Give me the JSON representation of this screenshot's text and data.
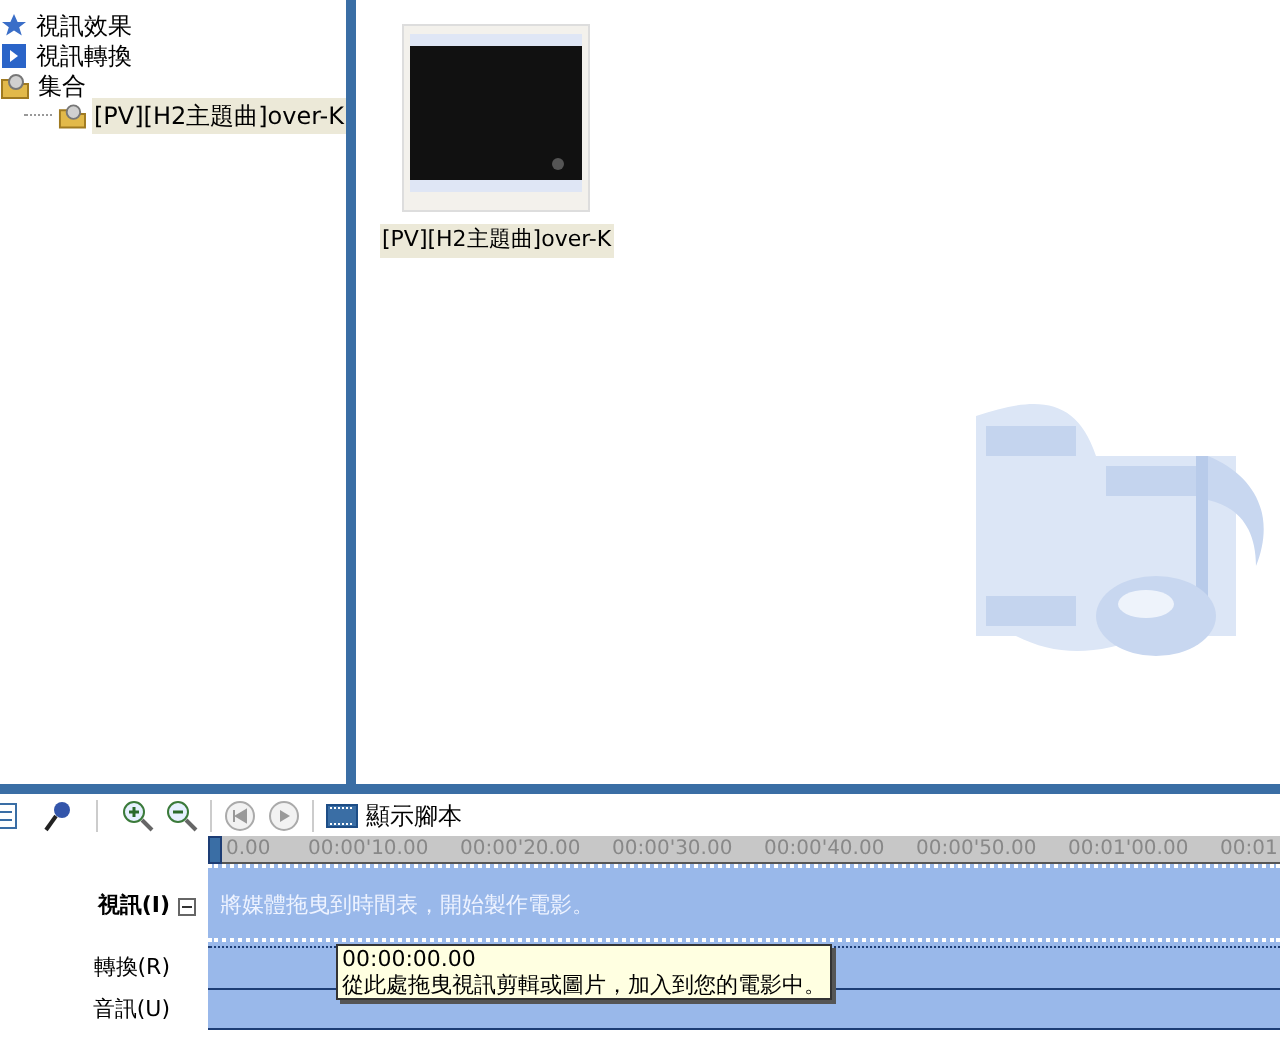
{
  "tree": [
    {
      "label": "視訊效果",
      "kind": "star",
      "selected": false
    },
    {
      "label": "視訊轉換",
      "kind": "transition",
      "selected": false
    },
    {
      "label": "集合",
      "kind": "collection",
      "selected": false,
      "children": [
        {
          "label": "[PV][H2主題曲]over-K",
          "kind": "collection",
          "selected": true
        }
      ]
    }
  ],
  "clips": [
    {
      "label": "[PV][H2主題曲]over-K",
      "selected": true
    }
  ],
  "toolbar": {
    "storyboard_label": "顯示腳本"
  },
  "ruler": {
    "ticks": [
      "0.00",
      "00:00'10.00",
      "00:00'20.00",
      "00:00'30.00",
      "00:00'40.00",
      "00:00'50.00",
      "00:01'00.00",
      "00:01"
    ]
  },
  "tracks": [
    {
      "kind": "video",
      "label": "視訊(I)",
      "expanded": true,
      "hint": "將媒體拖曳到時間表，開始製作電影。"
    },
    {
      "kind": "transition",
      "label": "轉換(R)"
    },
    {
      "kind": "audio",
      "label": "音訊(U)"
    }
  ],
  "tooltip": {
    "time": "00:00:00.00",
    "text": "從此處拖曳視訊剪輯或圖片，加入到您的電影中。"
  }
}
